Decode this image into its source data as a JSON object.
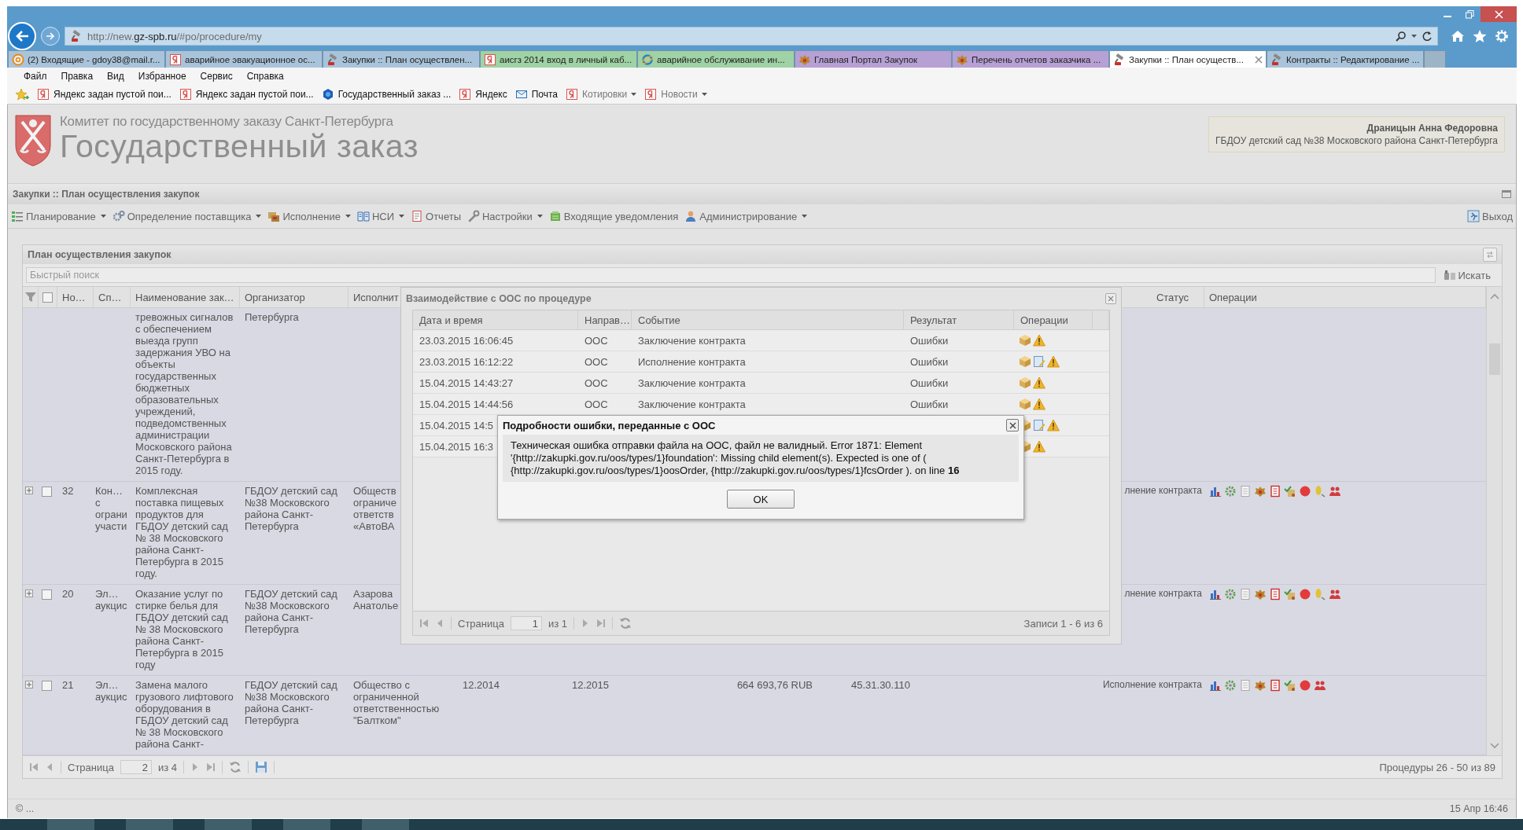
{
  "browser": {
    "url": "http://new.**gz-spb.ru**/#po/procedure/my",
    "tabs": [
      {
        "label": "(2) Входящие - gdoy38@mail.r...",
        "kind": "mail",
        "color": "#a9c4da",
        "selected": false
      },
      {
        "label": "аварийное эвакуационное ос...",
        "kind": "yandex",
        "color": "#a9c4da",
        "selected": false
      },
      {
        "label": "Закупки :: План осуществлен...",
        "kind": "gavel",
        "color": "#a9c4da",
        "selected": false
      },
      {
        "label": "аисгз 2014 вход в личный каб...",
        "kind": "yandex",
        "color": "#9fd2a4",
        "selected": false
      },
      {
        "label": "аварийное обслуживание ин...",
        "kind": "ie",
        "color": "#9fd2a4",
        "selected": false
      },
      {
        "label": "Главная Портал Закупок",
        "kind": "emblem",
        "color": "#b6a0d4",
        "selected": false
      },
      {
        "label": "Перечень отчетов заказчика ...",
        "kind": "emblem",
        "color": "#b6a0d4",
        "selected": false
      },
      {
        "label": "Закупки :: План осуществ...",
        "kind": "gavel",
        "selected": true
      },
      {
        "label": "Контракты :: Редактирование ...",
        "kind": "gavel",
        "color": "#a9c4da",
        "selected": false
      }
    ],
    "menu": [
      "Файл",
      "Правка",
      "Вид",
      "Избранное",
      "Сервис",
      "Справка"
    ],
    "favorites": [
      {
        "label": "Яндекс задан пустой пои...",
        "kind": "yandex",
        "dropdown": false
      },
      {
        "label": "Яндекс задан пустой пои...",
        "kind": "yandex",
        "dropdown": false
      },
      {
        "label": "Государственный заказ ...",
        "kind": "hexagon",
        "dropdown": false
      },
      {
        "label": "Яндекс",
        "kind": "yandex",
        "dropdown": false
      },
      {
        "label": "Почта",
        "kind": "envelope",
        "dropdown": false
      },
      {
        "label": "Котировки",
        "kind": "yandex",
        "dropdown": true
      },
      {
        "label": "Новости",
        "kind": "yandex",
        "dropdown": true
      }
    ]
  },
  "header": {
    "org": "Комитет по государственному заказу Санкт-Петербурга",
    "title": "Государственный заказ",
    "user": {
      "name": "Драницын Анна Федоровна",
      "org": "ГБДОУ детский сад №38 Московского района Санкт-Петербурга"
    }
  },
  "page_title": "Закупки :: План осуществления закупок",
  "toolbar": [
    {
      "label": "Планирование",
      "kind": "list",
      "dropdown": true
    },
    {
      "label": "Определение поставщика",
      "kind": "gears",
      "dropdown": true
    },
    {
      "label": "Исполнение",
      "kind": "folder",
      "dropdown": true
    },
    {
      "label": "НСИ",
      "kind": "book",
      "dropdown": true
    },
    {
      "label": "Отчеты",
      "kind": "report",
      "dropdown": false
    },
    {
      "label": "Настройки",
      "kind": "wrench",
      "dropdown": true
    },
    {
      "label": "Входящие уведомления",
      "kind": "inbox",
      "dropdown": false
    },
    {
      "label": "Администрирование",
      "kind": "user",
      "dropdown": true
    }
  ],
  "logout": "Выход",
  "panel": {
    "title": "План осуществления закупок",
    "search": {
      "placeholder": "Быстрый поиск"
    },
    "search_button": "Искать",
    "all_checked": false,
    "columns": [
      "Но…",
      "Сп…",
      "Наименование зак…",
      "Организатор",
      "Исполнит",
      "Статус",
      "Операции"
    ],
    "rows": [
      {
        "kind": "continued",
        "name": "тревожных сигналов\nс обеспечением\nвыезда групп\nзадержания УВО на\nобъекты\nгосударственных\nбюджетных\nобразовательных\nучреждений,\nподведомственных\nадминистрации\nМосковского района\nСанкт-Петербурга в\n2015 году.",
        "organizer": "Петербурга"
      },
      {
        "kind": "full",
        "expanded": false,
        "checked": false,
        "number": "32",
        "type": "Кон…\nс\nограни\nучасти",
        "name": "Комплексная\nпоставка пищевых\nпродуктов для\nГБДОУ детский сад\n№ 38 Московского\nрайона Санкт-\nПетербурга в 2015\nгоду.",
        "organizer": "ГБДОУ детский сад\n№38 Московского\nрайона Санкт-\nПетербурга",
        "executor": "Обществ\nограниче\nответств\n«АвтоВА",
        "status": "лнение контракта",
        "ops": [
          {
            "kind": "chart"
          },
          {
            "kind": "gear"
          },
          {
            "kind": "doc"
          },
          {
            "kind": "emblem"
          },
          {
            "kind": "notebook"
          },
          {
            "kind": "checklist"
          },
          {
            "kind": "dot"
          },
          {
            "kind": "coin"
          },
          {
            "kind": "people"
          }
        ]
      },
      {
        "kind": "full",
        "expanded": false,
        "checked": false,
        "number": "20",
        "type": "Эл…\nаукцис",
        "name": "Оказание услуг по\nстирке белья для\nГБДОУ детский сад\n№ 38 Московского\nрайона Санкт-\nПетербурга в 2015\nгоду",
        "organizer": "ГБДОУ детский сад\n№38 Московского\nрайона Санкт-\nПетербурга",
        "executor": "Азарова\nАнатолье",
        "status": "лнение контракта",
        "ops": [
          {
            "kind": "chart"
          },
          {
            "kind": "gear"
          },
          {
            "kind": "doc"
          },
          {
            "kind": "emblem"
          },
          {
            "kind": "notebook"
          },
          {
            "kind": "checklist"
          },
          {
            "kind": "dot"
          },
          {
            "kind": "coin"
          },
          {
            "kind": "people"
          }
        ]
      },
      {
        "kind": "full",
        "expanded": false,
        "checked": false,
        "number": "21",
        "type": "Эл…\nаукцис",
        "name": "Замена малого\nгрузового лифтового\nоборудования в\nГБДОУ детский сад\n№ 38 Московского\nрайона Санкт-",
        "organizer": "ГБДОУ детский сад\n№38 Московского\nрайона Санкт-\nПетербурга",
        "executor": "Общество с\nограниченной\nответственностью\n\"Балтком\"",
        "start": "12.2014",
        "end": "12.2015",
        "price": "664 693,76 RUB",
        "code": "45.31.30.110",
        "status": "Исполнение контракта",
        "ops": [
          {
            "kind": "chart"
          },
          {
            "kind": "gear"
          },
          {
            "kind": "doc"
          },
          {
            "kind": "emblem"
          },
          {
            "kind": "notebook"
          },
          {
            "kind": "checklist"
          },
          {
            "kind": "dot"
          },
          {
            "kind": "people"
          }
        ]
      }
    ],
    "pager": {
      "page_label": "Страница",
      "page": "2",
      "of": "из 4",
      "summary": "Процедуры 26 - 50 из 89"
    }
  },
  "footer": {
    "copyright": "© ...",
    "time": "15 Апр 16:46"
  },
  "dialog": {
    "title": "Взаимодействие с ООС по процедуре",
    "columns": [
      "Дата и время",
      "Направ…",
      "Событие",
      "Результат",
      "Операции"
    ],
    "rows": [
      {
        "date": "23.03.2015 16:06:45",
        "direction": "ООС",
        "event": "Заключение контракта",
        "result": "Ошибки",
        "ops": [
          {
            "kind": "box"
          },
          {
            "kind": "warning"
          }
        ]
      },
      {
        "date": "23.03.2015 16:12:22",
        "direction": "ООС",
        "event": "Исполнение контракта",
        "result": "Ошибки",
        "ops": [
          {
            "kind": "box"
          },
          {
            "kind": "docedit"
          },
          {
            "kind": "warning"
          }
        ]
      },
      {
        "date": "15.04.2015 14:43:27",
        "direction": "ООС",
        "event": "Заключение контракта",
        "result": "Ошибки",
        "ops": [
          {
            "kind": "box"
          },
          {
            "kind": "warning"
          }
        ]
      },
      {
        "date": "15.04.2015 14:44:56",
        "direction": "ООС",
        "event": "Заключение контракта",
        "result": "Ошибки",
        "ops": [
          {
            "kind": "box"
          },
          {
            "kind": "warning"
          }
        ]
      },
      {
        "date": "15.04.2015 14:5",
        "ops": [
          {
            "kind": "box"
          },
          {
            "kind": "docedit"
          },
          {
            "kind": "warning"
          }
        ]
      },
      {
        "date": "15.04.2015 16:3",
        "ops": [
          {
            "kind": "box"
          },
          {
            "kind": "warning"
          }
        ]
      }
    ],
    "pager": {
      "page_label": "Страница",
      "page": "1",
      "of": "из 1",
      "summary": "Записи 1 - 6 из 6"
    }
  },
  "error_dialog": {
    "title": "Подробности ошибки, переданные с ООС",
    "message": "Техническая ошибка отправки файла на ООС, файл не валидный. Error 1871: Element '{http://zakupki.gov.ru/oos/types/1}foundation': Missing child element(s). Expected is one of ( {http://zakupki.gov.ru/oos/types/1}oosOrder, {http://zakupki.gov.ru/oos/types/1}fcsOrder ). on line **16**",
    "button": "OK"
  }
}
